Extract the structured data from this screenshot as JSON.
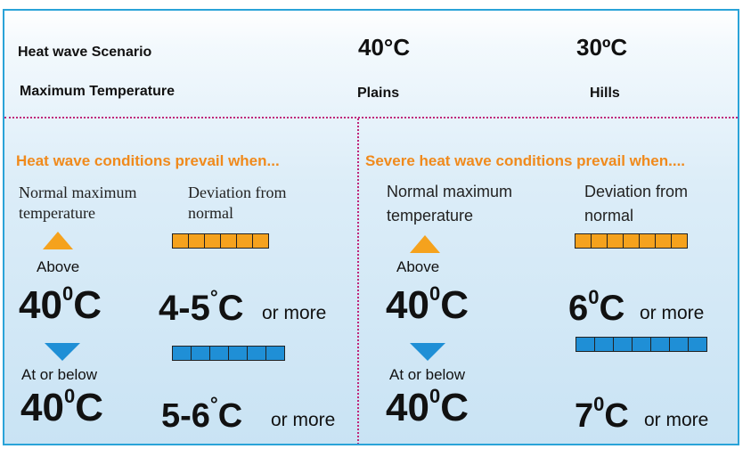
{
  "header": {
    "scenario_label": "Heat wave Scenario",
    "max_temp_label": "Maximum Temperature",
    "plains_temp": "40°C",
    "hills_temp": "30ºC",
    "plains_label": "Plains",
    "hills_label": "Hills"
  },
  "left": {
    "title": "Heat wave conditions prevail when...",
    "col1_line1": "Normal maximum",
    "col1_line2": "temperature",
    "col2_line1": "Deviation from",
    "col2_line2": "normal",
    "above_label": "Above",
    "above_temp_num": "40",
    "above_temp_sup": "0",
    "above_temp_unit": "C",
    "above_dev_num": "4-5",
    "above_dev_sup": "°",
    "above_dev_unit": "C",
    "above_more": "or more",
    "below_label": "At or below",
    "below_temp_num": "40",
    "below_temp_sup": "0",
    "below_temp_unit": "C",
    "below_dev_num": "5-6",
    "below_dev_sup": "°",
    "below_dev_unit": "C",
    "below_more": "or more"
  },
  "right": {
    "title": "Severe heat wave conditions prevail when....",
    "col1_line1": "Normal maximum",
    "col1_line2": "temperature",
    "col2_line1": "Deviation from",
    "col2_line2": "normal",
    "above_label": "Above",
    "above_temp_num": "40",
    "above_temp_sup": "0",
    "above_temp_unit": "C",
    "above_dev_num": "6",
    "above_dev_sup": "0",
    "above_dev_unit": "C",
    "above_more": "or more",
    "below_label": "At or below",
    "below_temp_num": "40",
    "below_temp_sup": "0",
    "below_temp_unit": "C",
    "below_dev_num": "7",
    "below_dev_sup": "0",
    "below_dev_unit": "C",
    "below_more": "or more"
  },
  "colors": {
    "border": "#2aa3d8",
    "divider": "#c0267a",
    "orange": "#f5a21d",
    "blue": "#1f8fd6",
    "title_orange": "#f08a1c"
  }
}
